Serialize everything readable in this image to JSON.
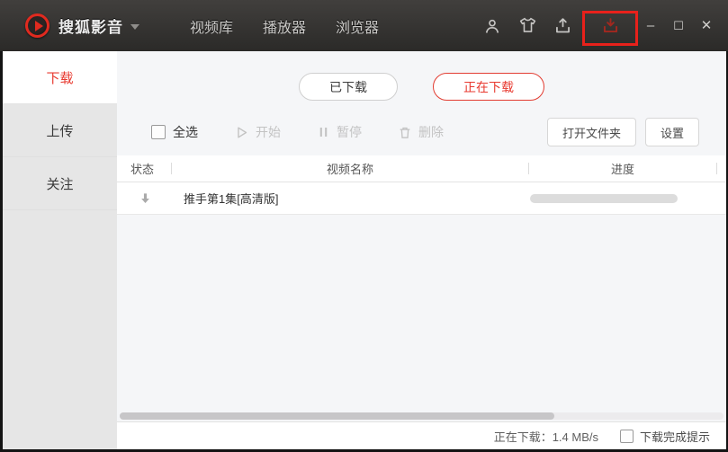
{
  "titlebar": {
    "app_name": "搜狐影音",
    "nav": [
      {
        "label": "视频库"
      },
      {
        "label": "播放器"
      },
      {
        "label": "浏览器"
      }
    ],
    "window_controls": {
      "minimize": "–",
      "maximize": "☐",
      "close": "✕"
    }
  },
  "sidebar": {
    "items": [
      {
        "label": "下载",
        "active": true
      },
      {
        "label": "上传",
        "active": false
      },
      {
        "label": "关注",
        "active": false
      }
    ]
  },
  "tabs": [
    {
      "label": "已下载",
      "active": false
    },
    {
      "label": "正在下载",
      "active": true
    }
  ],
  "toolbar": {
    "select_all_label": "全选",
    "start_label": "开始",
    "pause_label": "暂停",
    "delete_label": "删除",
    "open_folder_label": "打开文件夹",
    "settings_label": "设置"
  },
  "table": {
    "columns": [
      "状态",
      "视频名称",
      "进度"
    ],
    "rows": [
      {
        "status": "downloading",
        "name": "推手第1集[高清版]",
        "progress_percent": 5
      }
    ]
  },
  "statusbar": {
    "speed_text": "正在下载：1.4 MB/s",
    "notify_label": "下载完成提示",
    "notify_checked": false
  },
  "colors": {
    "accent_red": "#e8392f",
    "annotation_red": "#e8211b",
    "titlebar_dark": "#2b2a28",
    "sidebar_gray": "#e6e6e6",
    "content_bg": "#f5f6f8"
  }
}
